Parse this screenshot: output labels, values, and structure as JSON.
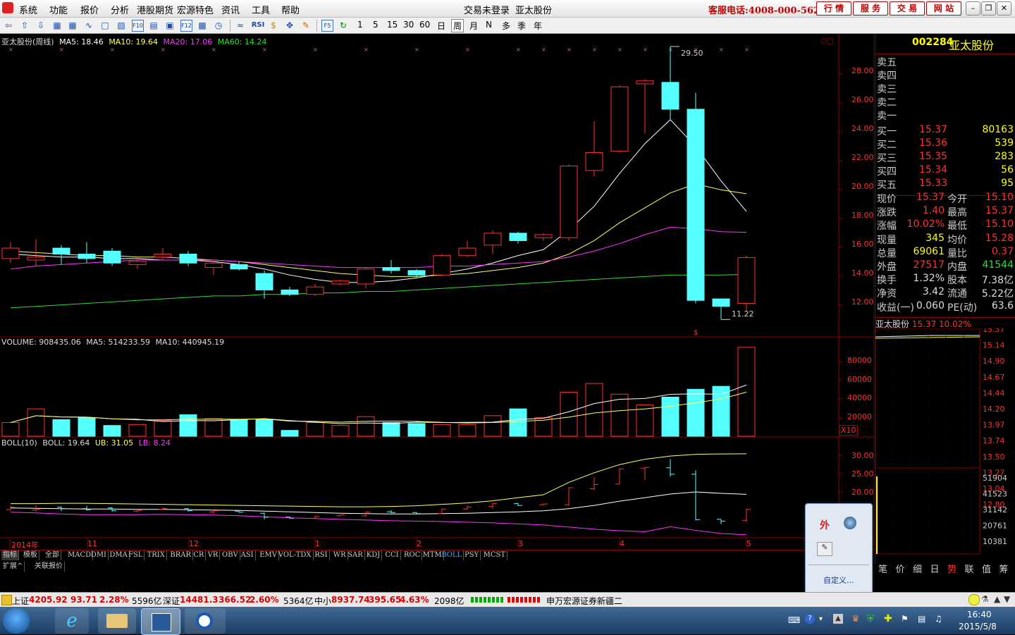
{
  "menu": {
    "items": [
      "系统",
      "功能",
      "报价",
      "分析",
      "港股期货",
      "宏源特色",
      "资讯",
      "工具",
      "帮助"
    ],
    "login_status": "交易未登录",
    "stock_title": "亚太股份",
    "hotline": "客服电话:4008-000-562",
    "quick_buttons": [
      "行  情",
      "服  务",
      "交  易",
      "网  站"
    ]
  },
  "toolbar": {
    "periods": [
      "1",
      "5",
      "15",
      "30",
      "60",
      "日",
      "周",
      "月",
      "N",
      "多",
      "季",
      "年"
    ],
    "rsi_label": "RSI"
  },
  "main_chart": {
    "title": "亚太股份(周线)",
    "ma5": "MA5: 18.46",
    "ma10": "MA10: 19.64",
    "ma20": "MA20: 17.06",
    "ma60": "MA60: 14.24",
    "high_marker": "29.50",
    "low_marker": "11.22",
    "y_ticks": [
      "28.00",
      "26.00",
      "24.00",
      "22.00",
      "20.00",
      "18.00",
      "16.00",
      "14.00",
      "12.00"
    ]
  },
  "volume_chart": {
    "title": "VOLUME: 908435.06",
    "ma5": "MA5: 514233.59",
    "ma10": "MA10: 440945.19",
    "y_ticks": [
      "80000",
      "60000",
      "40000",
      "20000"
    ],
    "unit_badge": "X10"
  },
  "boll_chart": {
    "title": "BOLL(10)",
    "boll": "BOLL: 19.64",
    "ub": "UB: 31.05",
    "lb": "LB: 8.24",
    "y_ticks": [
      "30.00",
      "25.00",
      "20.00"
    ]
  },
  "time_axis": [
    "2014年",
    "11",
    "12",
    "1",
    "2",
    "3",
    "4",
    "5"
  ],
  "chart_data": {
    "type": "candlestick",
    "period": "weekly",
    "candles": [
      {
        "o": 15.3,
        "c": 16.0,
        "h": 16.4,
        "l": 15.0
      },
      {
        "o": 15.2,
        "c": 15.4,
        "h": 16.6,
        "l": 14.8
      },
      {
        "o": 16.0,
        "c": 15.6,
        "h": 16.2,
        "l": 14.9
      },
      {
        "o": 15.6,
        "c": 15.3,
        "h": 16.4,
        "l": 15.0
      },
      {
        "o": 15.8,
        "c": 15.0,
        "h": 16.0,
        "l": 14.8
      },
      {
        "o": 14.9,
        "c": 15.1,
        "h": 15.4,
        "l": 14.6
      },
      {
        "o": 15.4,
        "c": 15.6,
        "h": 16.0,
        "l": 15.2
      },
      {
        "o": 15.6,
        "c": 15.0,
        "h": 15.8,
        "l": 14.8
      },
      {
        "o": 14.7,
        "c": 15.0,
        "h": 15.2,
        "l": 14.2
      },
      {
        "o": 14.9,
        "c": 14.6,
        "h": 15.1,
        "l": 14.5
      },
      {
        "o": 14.3,
        "c": 13.2,
        "h": 14.5,
        "l": 12.6
      },
      {
        "o": 13.2,
        "c": 12.9,
        "h": 13.4,
        "l": 12.8
      },
      {
        "o": 12.9,
        "c": 13.4,
        "h": 13.6,
        "l": 12.8
      },
      {
        "o": 13.6,
        "c": 13.8,
        "h": 13.9,
        "l": 13.5
      },
      {
        "o": 13.6,
        "c": 14.6,
        "h": 14.7,
        "l": 13.3
      },
      {
        "o": 14.7,
        "c": 14.5,
        "h": 15.2,
        "l": 14.3
      },
      {
        "o": 14.5,
        "c": 14.2,
        "h": 14.6,
        "l": 14.0
      },
      {
        "o": 14.2,
        "c": 15.5,
        "h": 15.6,
        "l": 14.1
      },
      {
        "o": 15.5,
        "c": 16.0,
        "h": 16.5,
        "l": 15.4
      },
      {
        "o": 16.2,
        "c": 17.0,
        "h": 17.2,
        "l": 15.6
      },
      {
        "o": 17.0,
        "c": 16.5,
        "h": 17.1,
        "l": 16.3
      },
      {
        "o": 16.7,
        "c": 16.9,
        "h": 17.0,
        "l": 16.5
      },
      {
        "o": 16.7,
        "c": 21.5,
        "h": 21.6,
        "l": 16.5
      },
      {
        "o": 21.2,
        "c": 22.4,
        "h": 24.5,
        "l": 20.8
      },
      {
        "o": 22.5,
        "c": 26.8,
        "h": 26.9,
        "l": 22.4
      },
      {
        "o": 27.0,
        "c": 27.2,
        "h": 27.3,
        "l": 23.7
      },
      {
        "o": 27.1,
        "c": 25.3,
        "h": 29.5,
        "l": 24.6
      },
      {
        "o": 25.3,
        "c": 12.5,
        "h": 26.4,
        "l": 12.3
      },
      {
        "o": 12.6,
        "c": 12.1,
        "h": 12.6,
        "l": 11.22
      },
      {
        "o": 12.3,
        "c": 15.37,
        "h": 15.5,
        "l": 11.8
      }
    ],
    "ylim": [
      11,
      29.5
    ],
    "ma_lines": [
      {
        "name": "MA5",
        "color": "#ffffff",
        "values": [
          15.6,
          15.5,
          15.4,
          15.4,
          15.3,
          15.3,
          15.2,
          15.2,
          15.1,
          14.9,
          14.6,
          14.2,
          13.9,
          13.7,
          13.7,
          13.8,
          14.0,
          14.3,
          14.6,
          15.0,
          15.5,
          15.9,
          17.2,
          18.8,
          21.0,
          23.0,
          24.6,
          22.8,
          20.5,
          18.46
        ]
      },
      {
        "name": "MA10",
        "color": "#ffff66",
        "values": [
          15.8,
          15.7,
          15.6,
          15.5,
          15.5,
          15.4,
          15.4,
          15.3,
          15.2,
          15.1,
          14.9,
          14.7,
          14.5,
          14.3,
          14.2,
          14.1,
          14.1,
          14.2,
          14.3,
          14.5,
          14.7,
          15.0,
          15.6,
          16.5,
          17.7,
          18.7,
          19.7,
          20.3,
          19.9,
          19.64
        ]
      },
      {
        "name": "MA20",
        "color": "#ff33ff",
        "values": [
          14.6,
          14.8,
          14.9,
          15.0,
          15.1,
          15.2,
          15.2,
          15.2,
          15.2,
          15.1,
          15.0,
          14.9,
          14.8,
          14.7,
          14.7,
          14.7,
          14.7,
          14.8,
          14.8,
          14.9,
          15.0,
          15.1,
          15.4,
          15.8,
          16.3,
          16.9,
          17.4,
          17.3,
          17.1,
          17.06
        ]
      },
      {
        "name": "MA60",
        "color": "#33dd33",
        "values": [
          12.0,
          12.1,
          12.2,
          12.3,
          12.4,
          12.5,
          12.6,
          12.7,
          12.8,
          12.8,
          12.9,
          12.9,
          13.0,
          13.0,
          13.1,
          13.1,
          13.2,
          13.3,
          13.4,
          13.5,
          13.6,
          13.7,
          13.8,
          13.9,
          14.0,
          14.1,
          14.2,
          14.2,
          14.2,
          14.24
        ]
      }
    ],
    "volume": [
      14000,
      28000,
      17000,
      19000,
      11000,
      12000,
      16000,
      22000,
      18000,
      17000,
      17000,
      6000,
      14000,
      11000,
      20000,
      14000,
      13000,
      12000,
      12000,
      21000,
      28000,
      19000,
      45000,
      54000,
      43000,
      32000,
      40000,
      48000,
      51000,
      90843
    ],
    "volume_ylim": [
      0,
      90000
    ],
    "boll": {
      "ub": [
        17.0,
        17.0,
        17.1,
        17.1,
        17.0,
        16.9,
        16.8,
        16.7,
        16.6,
        16.5,
        16.4,
        16.3,
        16.2,
        16.1,
        16.1,
        16.2,
        16.4,
        16.8,
        17.2,
        17.8,
        18.7,
        19.5,
        23.0,
        25.7,
        28.0,
        29.5,
        30.4,
        30.9,
        31.0,
        31.05
      ],
      "mid": [
        15.8,
        15.7,
        15.6,
        15.5,
        15.5,
        15.4,
        15.4,
        15.3,
        15.2,
        15.1,
        14.9,
        14.7,
        14.5,
        14.3,
        14.2,
        14.1,
        14.1,
        14.2,
        14.3,
        14.5,
        14.7,
        15.0,
        15.6,
        16.5,
        17.7,
        18.7,
        19.7,
        20.3,
        19.9,
        19.64
      ],
      "lb": [
        14.6,
        14.4,
        14.1,
        13.9,
        13.9,
        13.9,
        14.0,
        13.9,
        13.8,
        13.6,
        13.3,
        13.0,
        12.8,
        12.6,
        12.4,
        12.2,
        12.1,
        12.0,
        11.8,
        11.6,
        11.3,
        11.0,
        10.4,
        9.8,
        9.4,
        9.1,
        10.5,
        9.5,
        8.6,
        8.24
      ]
    },
    "boll_ylim": [
      8,
      33
    ]
  },
  "right_panel": {
    "code": "002284",
    "name": "亚太股份",
    "sell": [
      {
        "label": "卖五"
      },
      {
        "label": "卖四"
      },
      {
        "label": "卖三"
      },
      {
        "label": "卖二"
      },
      {
        "label": "卖一"
      }
    ],
    "buy": [
      {
        "label": "买一",
        "price": "15.37",
        "vol": "80163"
      },
      {
        "label": "买二",
        "price": "15.36",
        "vol": "539"
      },
      {
        "label": "买三",
        "price": "15.35",
        "vol": "283"
      },
      {
        "label": "买四",
        "price": "15.34",
        "vol": "56"
      },
      {
        "label": "买五",
        "price": "15.33",
        "vol": "95"
      }
    ],
    "stats": [
      {
        "n1": "现价",
        "v1": "15.37",
        "n2": "今开",
        "v2": "15.10"
      },
      {
        "n1": "涨跌",
        "v1": "1.40",
        "n2": "最高",
        "v2": "15.37"
      },
      {
        "n1": "涨幅",
        "v1": "10.02%",
        "n2": "最低",
        "v2": "15.10"
      },
      {
        "n1": "现量",
        "v1": "345",
        "n2": "均价",
        "v2": "15.28"
      },
      {
        "n1": "总量",
        "v1": "69061",
        "n2": "量比",
        "v2": "0.37"
      },
      {
        "n1": "外盘",
        "v1": "27517",
        "n2": "内盘",
        "v2": "41544"
      },
      {
        "n1": "换手",
        "v1": "1.32%",
        "n2": "股本",
        "v2": "7.38亿"
      },
      {
        "n1": "净资",
        "v1": "3.42",
        "n2": "流通",
        "v2": "5.22亿"
      },
      {
        "n1": "收益(一)",
        "v1": "0.060",
        "n2": "PE(动)",
        "v2": "63.6"
      }
    ],
    "mini_title_name": "亚太股份",
    "mini_title_price": "15.37",
    "mini_title_pct": "10.02%",
    "mini_ticks": [
      "15.37",
      "15.14",
      "14.90",
      "14.67",
      "14.44",
      "14.20",
      "13.97",
      "13.74",
      "13.50",
      "13.27",
      "13.04",
      "12.80"
    ],
    "mini_vol_ticks": [
      "51904",
      "41523",
      "31142",
      "20761",
      "10381"
    ],
    "bottom_tabs": [
      "笔",
      "价",
      "细",
      "日",
      "势",
      "联",
      "值",
      "筹"
    ]
  },
  "indicator_tabs": {
    "side": [
      "指标",
      "模板",
      "全部"
    ],
    "items": [
      "MACD",
      "DMI",
      "DMA",
      "FSL",
      "TRIX",
      "BRAR",
      "CR",
      "VR",
      "OBV",
      "ASI",
      "EMV",
      "VOL-TDX",
      "RSI",
      "WR",
      "SAR",
      "KDJ",
      "CCI",
      "ROC",
      "MTM",
      "BOLL",
      "PSY",
      "MCST"
    ],
    "active": "BOLL",
    "row2": [
      "扩展^",
      "关联报价"
    ]
  },
  "popup": {
    "custom_label": "自定义..."
  },
  "statusbar": {
    "sh_label": "上证",
    "sh_index": "4205.92",
    "sh_change": "93.71",
    "sh_pct": "2.28%",
    "sh_amount": "5596亿",
    "sz_label": "深证",
    "sz_index": "14481.3",
    "sz_change": "366.52",
    "sz_pct": "2.60%",
    "sz_amount": "5364亿",
    "zx_label": "中小",
    "zx_index": "8937.74",
    "zx_change": "395.65",
    "zx_pct": "4.63%",
    "zx_amount": "2098亿",
    "broker": "申万宏源证券新疆二"
  },
  "taskbar": {
    "time": "16:40",
    "date": "2015/5/8"
  },
  "colors": {
    "up": "#ff3232",
    "down": "#54ffff",
    "grid": "#8b0000",
    "yellow": "#ffff00"
  }
}
